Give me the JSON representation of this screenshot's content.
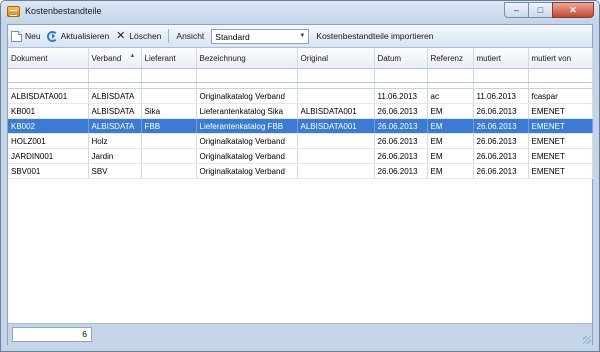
{
  "window": {
    "title": "Kostenbestandteile"
  },
  "toolbar": {
    "new_label": "Neu",
    "refresh_label": "Aktualisieren",
    "delete_label": "Löschen",
    "view_label": "Ansicht",
    "view_value": "Standard",
    "import_label": "Kostenbestandteile importieren"
  },
  "table": {
    "columns": [
      "Dokument",
      "Verband",
      "Lieferant",
      "Bezeichnung",
      "Original",
      "Datum",
      "Referenz",
      "mutiert",
      "mutiert von"
    ],
    "sort_column": "Verband",
    "rows": [
      [
        "ALBISDATA001",
        "ALBISDATA",
        "",
        "Originalkatalog Verband",
        "",
        "11.06.2013",
        "ac",
        "11.06.2013",
        "fcaspar"
      ],
      [
        "KB001",
        "ALBISDATA",
        "Sika",
        "Lieferantenkatalog Sika",
        "ALBISDATA001",
        "26.06.2013",
        "EM",
        "26.06.2013",
        "EMENET"
      ],
      [
        "KB002",
        "ALBISDATA",
        "FBB",
        "Lieferantenkatalog FBB",
        "ALBISDATA001",
        "26.06.2013",
        "EM",
        "26.06.2013",
        "EMENET"
      ],
      [
        "HOLZ001",
        "Holz",
        "",
        "Originalkatalog Verband",
        "",
        "26.06.2013",
        "EM",
        "26.06.2013",
        "EMENET"
      ],
      [
        "JARDIN001",
        "Jardin",
        "",
        "Originalkatalog Verband",
        "",
        "26.06.2013",
        "EM",
        "26.06.2013",
        "EMENET"
      ],
      [
        "SBV001",
        "SBV",
        "",
        "Originalkatalog Verband",
        "",
        "26.06.2013",
        "EM",
        "26.06.2013",
        "EMENET"
      ]
    ],
    "selected_row": 2
  },
  "footer": {
    "count": "6"
  },
  "colors": {
    "selection": "#3c7bd3",
    "frame": "#c4d5ea",
    "close_button": "#c6472f"
  }
}
